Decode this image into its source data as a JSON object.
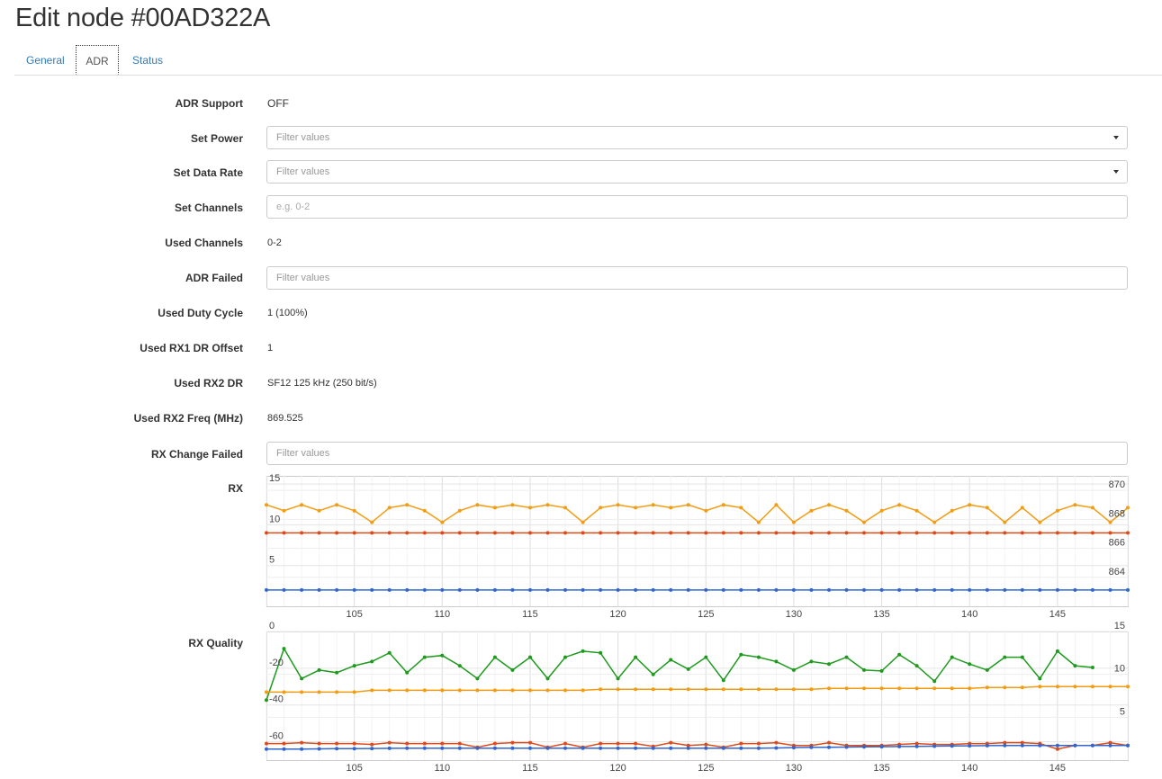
{
  "page": {
    "title": "Edit node #00AD322A"
  },
  "tabs": [
    {
      "label": "General",
      "active": false
    },
    {
      "label": "ADR",
      "active": true
    },
    {
      "label": "Status",
      "active": false
    }
  ],
  "form": {
    "adr_support": {
      "label": "ADR Support",
      "value": "OFF"
    },
    "set_power": {
      "label": "Set Power",
      "placeholder": "Filter values"
    },
    "set_data_rate": {
      "label": "Set Data Rate",
      "placeholder": "Filter values"
    },
    "set_channels": {
      "label": "Set Channels",
      "placeholder": "e.g. 0-2"
    },
    "used_channels": {
      "label": "Used Channels",
      "value": "0-2"
    },
    "adr_failed": {
      "label": "ADR Failed",
      "placeholder": "Filter values"
    },
    "used_duty_cycle": {
      "label": "Used Duty Cycle",
      "value": "1 (100%)"
    },
    "used_rx1_dr_offset": {
      "label": "Used RX1 DR Offset",
      "value": "1"
    },
    "used_rx2_dr": {
      "label": "Used RX2 DR",
      "value": "SF12 125 kHz (250 bit/s)"
    },
    "used_rx2_freq": {
      "label": "Used RX2 Freq (MHz)",
      "value": "869.525"
    },
    "rx_change_failed": {
      "label": "RX Change Failed",
      "placeholder": "Filter values"
    },
    "rx_chart_label": "RX",
    "rx_quality_chart_label": "RX Quality"
  },
  "colors": {
    "orange": "#f39c12",
    "red": "#dd4b1a",
    "blue": "#3366cc",
    "green": "#1e9a1e"
  },
  "chart_data": [
    {
      "type": "line",
      "x_range": [
        100,
        149
      ],
      "x_ticks": [
        105,
        110,
        115,
        120,
        125,
        130,
        135,
        140,
        145
      ],
      "y_left_ticks": [
        5,
        10,
        15
      ],
      "y_left_range": [
        0,
        16
      ],
      "y_right_ticks": [
        864,
        866,
        868,
        870
      ],
      "y_right_range": [
        862,
        871
      ],
      "grid": true,
      "series": [
        {
          "color": "orange",
          "axis": "right",
          "values": [
            869.0,
            868.6,
            869.0,
            868.6,
            869.0,
            868.6,
            867.8,
            868.8,
            869.0,
            868.6,
            867.8,
            868.6,
            869.0,
            868.8,
            869.0,
            868.8,
            869.0,
            868.8,
            867.8,
            868.8,
            869.0,
            868.8,
            869.0,
            868.8,
            869.0,
            868.6,
            869.0,
            868.8,
            867.8,
            869.0,
            867.8,
            868.6,
            869.0,
            868.6,
            867.8,
            868.6,
            869.0,
            868.6,
            867.8,
            868.6,
            869.0,
            868.8,
            867.8,
            868.8,
            867.8,
            868.6,
            869.0,
            868.8,
            867.8,
            868.8
          ]
        },
        {
          "color": "red",
          "axis": "left",
          "values": [
            9,
            9,
            9,
            9,
            9,
            9,
            9,
            9,
            9,
            9,
            9,
            9,
            9,
            9,
            9,
            9,
            9,
            9,
            9,
            9,
            9,
            9,
            9,
            9,
            9,
            9,
            9,
            9,
            9,
            9,
            9,
            9,
            9,
            9,
            9,
            9,
            9,
            9,
            9,
            9,
            9,
            9,
            9,
            9,
            9,
            9,
            9,
            9,
            9,
            9
          ]
        },
        {
          "color": "blue",
          "axis": "left",
          "values": [
            2,
            2,
            2,
            2,
            2,
            2,
            2,
            2,
            2,
            2,
            2,
            2,
            2,
            2,
            2,
            2,
            2,
            2,
            2,
            2,
            2,
            2,
            2,
            2,
            2,
            2,
            2,
            2,
            2,
            2,
            2,
            2,
            2,
            2,
            2,
            2,
            2,
            2,
            2,
            2,
            2,
            2,
            2,
            2,
            2,
            2,
            2,
            2,
            2,
            2
          ]
        }
      ]
    },
    {
      "type": "line",
      "x_range": [
        100,
        149
      ],
      "x_ticks": [
        105,
        110,
        115,
        120,
        125,
        130,
        135,
        140,
        145
      ],
      "y_left_ticks": [
        0,
        -20,
        -40,
        -60
      ],
      "y_left_range": [
        -70,
        0
      ],
      "y_right_ticks": [
        15,
        10,
        5
      ],
      "y_right_range": [
        0,
        15
      ],
      "grid": true,
      "series": [
        {
          "color": "green",
          "axis": "right",
          "values": [
            7,
            13,
            9.5,
            10.5,
            10.2,
            11,
            11.5,
            12.5,
            10.2,
            12,
            12.2,
            11,
            9.5,
            12,
            10.5,
            12,
            9.5,
            12,
            12.7,
            12.5,
            9.5,
            12,
            10,
            11.7,
            10.6,
            12,
            9.3,
            12.3,
            12,
            11.5,
            10.5,
            11.5,
            11.2,
            12,
            10.5,
            10.4,
            12.3,
            11,
            9.2,
            12,
            11.2,
            10.5,
            12,
            12,
            9.5,
            12.7,
            11,
            10.8
          ]
        },
        {
          "color": "orange",
          "axis": "left",
          "values": [
            -33,
            -33,
            -33,
            -33,
            -33,
            -33,
            -32,
            -32,
            -32,
            -32,
            -32,
            -32,
            -32,
            -32,
            -32,
            -32,
            -32,
            -32,
            -32,
            -31.5,
            -31.5,
            -31.5,
            -31.5,
            -31.5,
            -31.5,
            -31.5,
            -31.5,
            -31.5,
            -31.5,
            -31.5,
            -31.5,
            -31.5,
            -31,
            -31,
            -31,
            -31,
            -31,
            -31,
            -31,
            -31,
            -31,
            -30.5,
            -30.5,
            -30.5,
            -30,
            -30,
            -30,
            -30,
            -30,
            -30
          ]
        },
        {
          "color": "red",
          "axis": "left",
          "values": [
            -61,
            -61,
            -60.5,
            -61,
            -61,
            -61,
            -61.5,
            -60.5,
            -61,
            -61,
            -61,
            -61,
            -63,
            -61,
            -60.5,
            -60.5,
            -63,
            -61,
            -63,
            -61,
            -61,
            -61,
            -62.5,
            -60.5,
            -62,
            -61.5,
            -63,
            -61,
            -61,
            -60.5,
            -62,
            -62,
            -60.5,
            -62,
            -62,
            -62,
            -61.5,
            -61,
            -61.5,
            -61.5,
            -61,
            -61,
            -60.5,
            -60.5,
            -61,
            -64,
            -62,
            -62,
            -60.5,
            -62,
            -60.5
          ]
        },
        {
          "color": "blue",
          "axis": "left",
          "values": [
            -64,
            -64,
            -64,
            -63.9,
            -63.8,
            -63.8,
            -63.7,
            -63.6,
            -63.5,
            -63.5,
            -63.5,
            -63.5,
            -63.5,
            -63.5,
            -63.5,
            -63.5,
            -63.5,
            -63.5,
            -63.5,
            -63.5,
            -63.5,
            -63.5,
            -63.5,
            -63.5,
            -63.5,
            -63.5,
            -63.5,
            -63.5,
            -63.5,
            -63.4,
            -63.2,
            -63,
            -63,
            -62.9,
            -62.8,
            -62.7,
            -62.6,
            -62.5,
            -62.4,
            -62.3,
            -62.2,
            -62.1,
            -62,
            -62,
            -62,
            -62,
            -62,
            -62,
            -62,
            -62
          ]
        }
      ]
    }
  ]
}
